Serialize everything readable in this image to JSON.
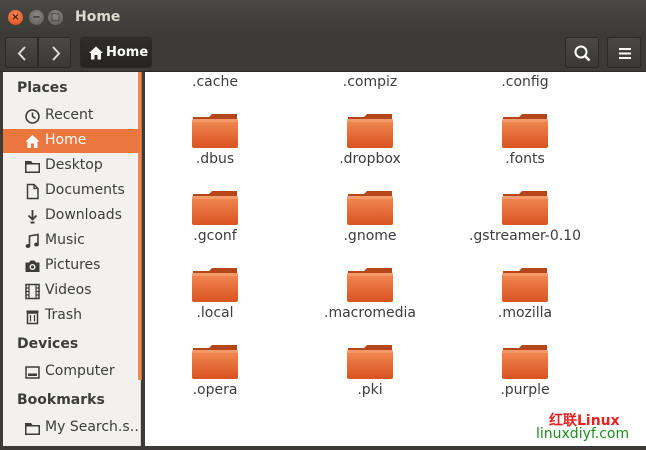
{
  "window": {
    "title": "Home"
  },
  "toolbar": {
    "path_label": "Home"
  },
  "sidebar": {
    "sections": [
      {
        "label": "Places",
        "items": [
          {
            "label": "Recent",
            "icon": "clock-icon"
          },
          {
            "label": "Home",
            "icon": "home-icon",
            "active": true
          },
          {
            "label": "Desktop",
            "icon": "desktop-folder-icon"
          },
          {
            "label": "Documents",
            "icon": "document-icon"
          },
          {
            "label": "Downloads",
            "icon": "download-icon"
          },
          {
            "label": "Music",
            "icon": "music-icon"
          },
          {
            "label": "Pictures",
            "icon": "camera-icon"
          },
          {
            "label": "Videos",
            "icon": "film-icon"
          },
          {
            "label": "Trash",
            "icon": "trash-icon"
          }
        ]
      },
      {
        "label": "Devices",
        "items": [
          {
            "label": "Computer",
            "icon": "drive-icon"
          }
        ]
      },
      {
        "label": "Bookmarks",
        "items": [
          {
            "label": "My Search.s…",
            "icon": "folder-icon"
          }
        ]
      }
    ]
  },
  "files": [
    ".cache",
    ".compiz",
    ".config",
    ".dbus",
    ".dropbox",
    ".fonts",
    ".gconf",
    ".gnome",
    ".gstreamer-0.10",
    ".local",
    ".macromedia",
    ".mozilla",
    ".opera",
    ".pki",
    ".purple"
  ],
  "watermark": {
    "line1": "红联Linux",
    "line2": "linuxdiyf.com"
  },
  "colors": {
    "accent": "#e9773e",
    "titlebar": "#3c3b37",
    "folder": "#e2602a"
  }
}
